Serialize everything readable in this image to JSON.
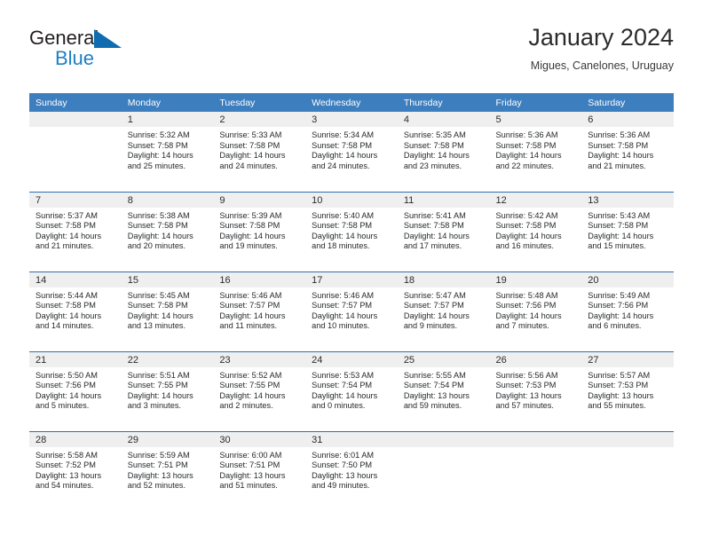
{
  "brand": {
    "name_part1": "General",
    "name_part2": "Blue",
    "flag_icon": "blue-triangle-flag-icon",
    "accent_color": "#1f7fc4"
  },
  "header": {
    "title": "January 2024",
    "location": "Migues, Canelones, Uruguay"
  },
  "theme": {
    "header_bg": "#3d7ebe",
    "row_divider": "#2f6fae",
    "daynum_bg": "#efeff0",
    "text": "#27292b"
  },
  "weekday_headers": [
    "Sunday",
    "Monday",
    "Tuesday",
    "Wednesday",
    "Thursday",
    "Friday",
    "Saturday"
  ],
  "weeks": [
    [
      {
        "day": "",
        "lines": []
      },
      {
        "day": "1",
        "lines": [
          "Sunrise: 5:32 AM",
          "Sunset: 7:58 PM",
          "Daylight: 14 hours",
          "and 25 minutes."
        ]
      },
      {
        "day": "2",
        "lines": [
          "Sunrise: 5:33 AM",
          "Sunset: 7:58 PM",
          "Daylight: 14 hours",
          "and 24 minutes."
        ]
      },
      {
        "day": "3",
        "lines": [
          "Sunrise: 5:34 AM",
          "Sunset: 7:58 PM",
          "Daylight: 14 hours",
          "and 24 minutes."
        ]
      },
      {
        "day": "4",
        "lines": [
          "Sunrise: 5:35 AM",
          "Sunset: 7:58 PM",
          "Daylight: 14 hours",
          "and 23 minutes."
        ]
      },
      {
        "day": "5",
        "lines": [
          "Sunrise: 5:36 AM",
          "Sunset: 7:58 PM",
          "Daylight: 14 hours",
          "and 22 minutes."
        ]
      },
      {
        "day": "6",
        "lines": [
          "Sunrise: 5:36 AM",
          "Sunset: 7:58 PM",
          "Daylight: 14 hours",
          "and 21 minutes."
        ]
      }
    ],
    [
      {
        "day": "7",
        "lines": [
          "Sunrise: 5:37 AM",
          "Sunset: 7:58 PM",
          "Daylight: 14 hours",
          "and 21 minutes."
        ]
      },
      {
        "day": "8",
        "lines": [
          "Sunrise: 5:38 AM",
          "Sunset: 7:58 PM",
          "Daylight: 14 hours",
          "and 20 minutes."
        ]
      },
      {
        "day": "9",
        "lines": [
          "Sunrise: 5:39 AM",
          "Sunset: 7:58 PM",
          "Daylight: 14 hours",
          "and 19 minutes."
        ]
      },
      {
        "day": "10",
        "lines": [
          "Sunrise: 5:40 AM",
          "Sunset: 7:58 PM",
          "Daylight: 14 hours",
          "and 18 minutes."
        ]
      },
      {
        "day": "11",
        "lines": [
          "Sunrise: 5:41 AM",
          "Sunset: 7:58 PM",
          "Daylight: 14 hours",
          "and 17 minutes."
        ]
      },
      {
        "day": "12",
        "lines": [
          "Sunrise: 5:42 AM",
          "Sunset: 7:58 PM",
          "Daylight: 14 hours",
          "and 16 minutes."
        ]
      },
      {
        "day": "13",
        "lines": [
          "Sunrise: 5:43 AM",
          "Sunset: 7:58 PM",
          "Daylight: 14 hours",
          "and 15 minutes."
        ]
      }
    ],
    [
      {
        "day": "14",
        "lines": [
          "Sunrise: 5:44 AM",
          "Sunset: 7:58 PM",
          "Daylight: 14 hours",
          "and 14 minutes."
        ]
      },
      {
        "day": "15",
        "lines": [
          "Sunrise: 5:45 AM",
          "Sunset: 7:58 PM",
          "Daylight: 14 hours",
          "and 13 minutes."
        ]
      },
      {
        "day": "16",
        "lines": [
          "Sunrise: 5:46 AM",
          "Sunset: 7:57 PM",
          "Daylight: 14 hours",
          "and 11 minutes."
        ]
      },
      {
        "day": "17",
        "lines": [
          "Sunrise: 5:46 AM",
          "Sunset: 7:57 PM",
          "Daylight: 14 hours",
          "and 10 minutes."
        ]
      },
      {
        "day": "18",
        "lines": [
          "Sunrise: 5:47 AM",
          "Sunset: 7:57 PM",
          "Daylight: 14 hours",
          "and 9 minutes."
        ]
      },
      {
        "day": "19",
        "lines": [
          "Sunrise: 5:48 AM",
          "Sunset: 7:56 PM",
          "Daylight: 14 hours",
          "and 7 minutes."
        ]
      },
      {
        "day": "20",
        "lines": [
          "Sunrise: 5:49 AM",
          "Sunset: 7:56 PM",
          "Daylight: 14 hours",
          "and 6 minutes."
        ]
      }
    ],
    [
      {
        "day": "21",
        "lines": [
          "Sunrise: 5:50 AM",
          "Sunset: 7:56 PM",
          "Daylight: 14 hours",
          "and 5 minutes."
        ]
      },
      {
        "day": "22",
        "lines": [
          "Sunrise: 5:51 AM",
          "Sunset: 7:55 PM",
          "Daylight: 14 hours",
          "and 3 minutes."
        ]
      },
      {
        "day": "23",
        "lines": [
          "Sunrise: 5:52 AM",
          "Sunset: 7:55 PM",
          "Daylight: 14 hours",
          "and 2 minutes."
        ]
      },
      {
        "day": "24",
        "lines": [
          "Sunrise: 5:53 AM",
          "Sunset: 7:54 PM",
          "Daylight: 14 hours",
          "and 0 minutes."
        ]
      },
      {
        "day": "25",
        "lines": [
          "Sunrise: 5:55 AM",
          "Sunset: 7:54 PM",
          "Daylight: 13 hours",
          "and 59 minutes."
        ]
      },
      {
        "day": "26",
        "lines": [
          "Sunrise: 5:56 AM",
          "Sunset: 7:53 PM",
          "Daylight: 13 hours",
          "and 57 minutes."
        ]
      },
      {
        "day": "27",
        "lines": [
          "Sunrise: 5:57 AM",
          "Sunset: 7:53 PM",
          "Daylight: 13 hours",
          "and 55 minutes."
        ]
      }
    ],
    [
      {
        "day": "28",
        "lines": [
          "Sunrise: 5:58 AM",
          "Sunset: 7:52 PM",
          "Daylight: 13 hours",
          "and 54 minutes."
        ]
      },
      {
        "day": "29",
        "lines": [
          "Sunrise: 5:59 AM",
          "Sunset: 7:51 PM",
          "Daylight: 13 hours",
          "and 52 minutes."
        ]
      },
      {
        "day": "30",
        "lines": [
          "Sunrise: 6:00 AM",
          "Sunset: 7:51 PM",
          "Daylight: 13 hours",
          "and 51 minutes."
        ]
      },
      {
        "day": "31",
        "lines": [
          "Sunrise: 6:01 AM",
          "Sunset: 7:50 PM",
          "Daylight: 13 hours",
          "and 49 minutes."
        ]
      },
      {
        "day": "",
        "lines": []
      },
      {
        "day": "",
        "lines": []
      },
      {
        "day": "",
        "lines": []
      }
    ]
  ]
}
